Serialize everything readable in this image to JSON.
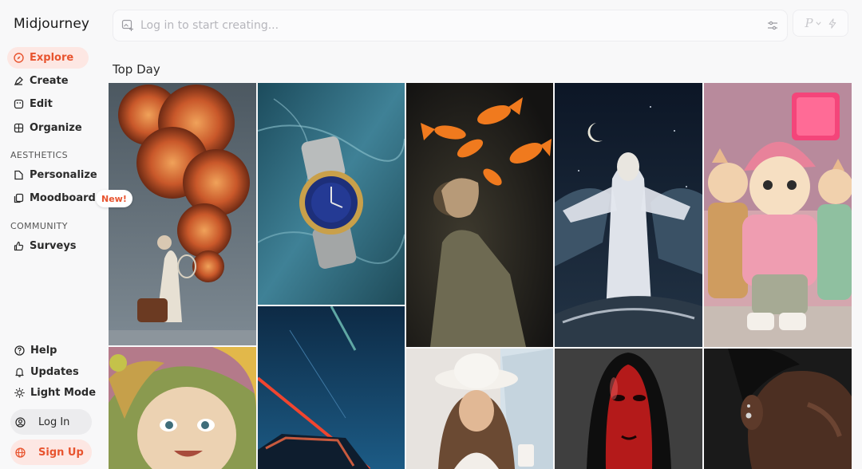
{
  "app": {
    "brand": "Midjourney"
  },
  "nav": {
    "explore": "Explore",
    "create": "Create",
    "edit": "Edit",
    "organize": "Organize"
  },
  "sections": {
    "aesthetics": "AESTHETICS",
    "community": "COMMUNITY"
  },
  "aesthetics": {
    "personalize": "Personalize",
    "moodboards": "Moodboards",
    "new_badge": "New!"
  },
  "community": {
    "surveys": "Surveys"
  },
  "footer": {
    "help": "Help",
    "updates": "Updates",
    "light_mode": "Light Mode",
    "login": "Log In",
    "signup": "Sign Up"
  },
  "search": {
    "placeholder": "Log in to start creating..."
  },
  "mode": {
    "letter": "P"
  },
  "main": {
    "title": "Top Day"
  },
  "colors": {
    "accent": "#e8542f",
    "accent_bg": "#fde7e3"
  }
}
